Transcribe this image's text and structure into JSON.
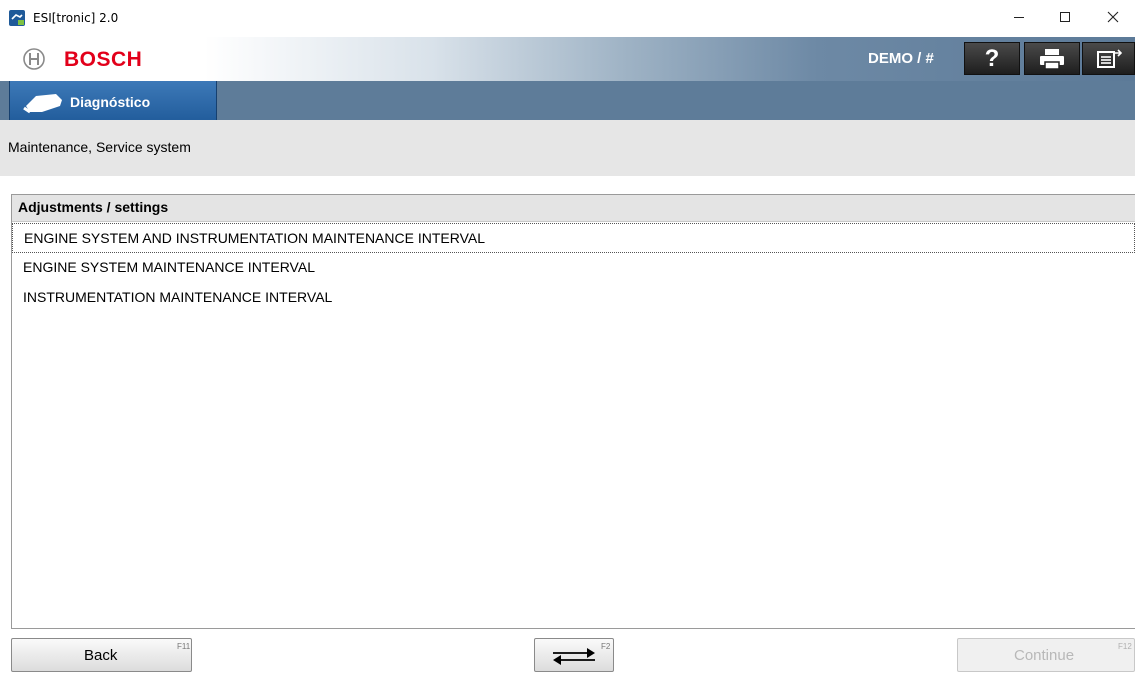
{
  "window": {
    "title": "ESI[tronic] 2.0",
    "icons": [
      "app-icon",
      "minimize-icon",
      "maximize-icon",
      "close-icon"
    ]
  },
  "brand": {
    "name": "BOSCH",
    "user_label": "DEMO / #",
    "brand_color": "#e2001a",
    "toolbar": [
      {
        "name": "help-button",
        "icon": "question-mark-icon",
        "label": "?"
      },
      {
        "name": "print-button",
        "icon": "printer-icon"
      },
      {
        "name": "export-button",
        "icon": "list-export-icon"
      }
    ]
  },
  "nav": {
    "tab_label": "Diagnóstico",
    "tab_icon": "diagnostic-connector-icon",
    "band_color": "#5e7c99",
    "tab_color": "#2b69a8"
  },
  "breadcrumb": {
    "text": "Maintenance, Service system"
  },
  "list": {
    "header": "Adjustments / settings",
    "items": [
      {
        "label": "ENGINE SYSTEM AND INSTRUMENTATION MAINTENANCE INTERVAL",
        "selected": true
      },
      {
        "label": "ENGINE SYSTEM MAINTENANCE INTERVAL",
        "selected": false
      },
      {
        "label": "INSTRUMENTATION MAINTENANCE INTERVAL",
        "selected": false
      }
    ]
  },
  "footer": {
    "back": {
      "label": "Back",
      "fkey": "F11"
    },
    "toggle": {
      "icon": "swap-arrows-icon",
      "fkey": "F2"
    },
    "continue": {
      "label": "Continue",
      "fkey": "F12",
      "enabled": false
    }
  }
}
